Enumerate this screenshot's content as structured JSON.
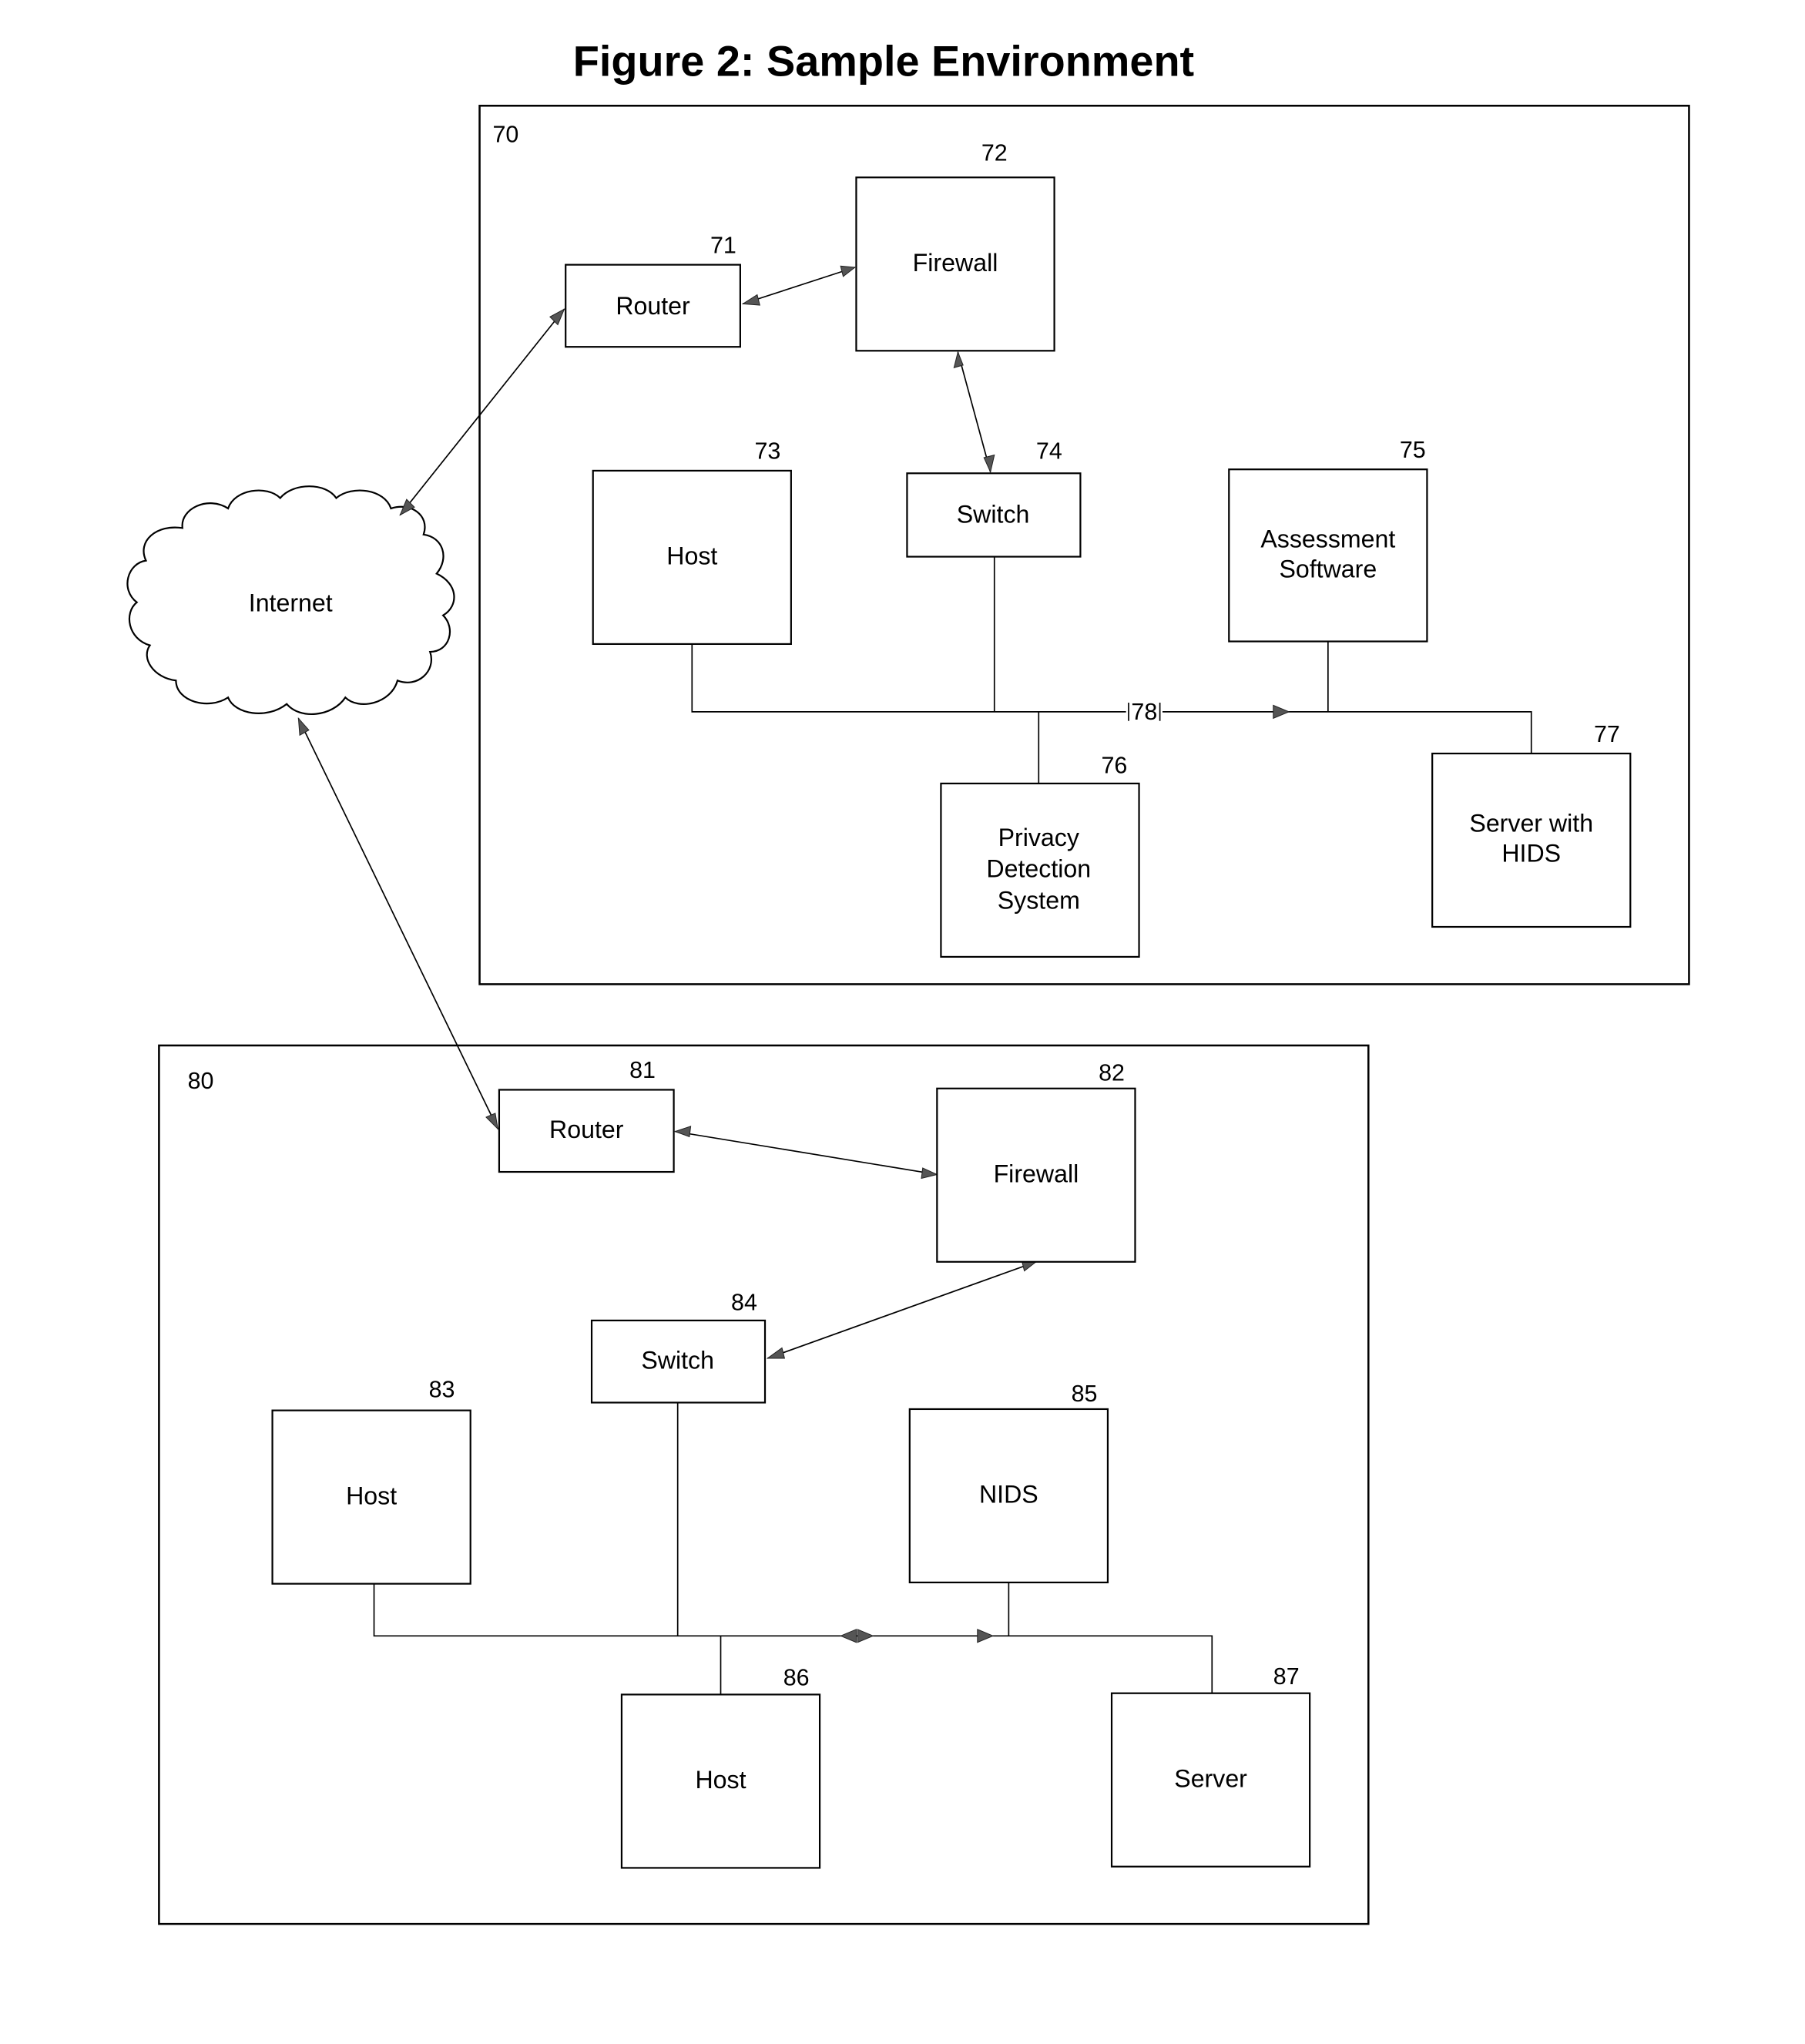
{
  "title": "Figure 2: Sample Environment",
  "internet": {
    "label": "Internet"
  },
  "network_70": {
    "ref": "70",
    "nodes": [
      {
        "ref": "71",
        "label": [
          "Router"
        ]
      },
      {
        "ref": "72",
        "label": [
          "Firewall"
        ]
      },
      {
        "ref": "73",
        "label": [
          "Host"
        ]
      },
      {
        "ref": "74",
        "label": [
          "Switch"
        ]
      },
      {
        "ref": "75",
        "label": [
          "Assessment",
          "Software"
        ]
      },
      {
        "ref": "76",
        "label": [
          "Privacy",
          "Detection",
          "System"
        ]
      },
      {
        "ref": "77",
        "label": [
          "Server with",
          "HIDS"
        ]
      }
    ],
    "link_ref": "78"
  },
  "network_80": {
    "ref": "80",
    "nodes": [
      {
        "ref": "81",
        "label": [
          "Router"
        ]
      },
      {
        "ref": "82",
        "label": [
          "Firewall"
        ]
      },
      {
        "ref": "83",
        "label": [
          "Host"
        ]
      },
      {
        "ref": "84",
        "label": [
          "Switch"
        ]
      },
      {
        "ref": "85",
        "label": [
          "NIDS"
        ]
      },
      {
        "ref": "86",
        "label": [
          "Host"
        ]
      },
      {
        "ref": "87",
        "label": [
          "Server"
        ]
      }
    ]
  }
}
